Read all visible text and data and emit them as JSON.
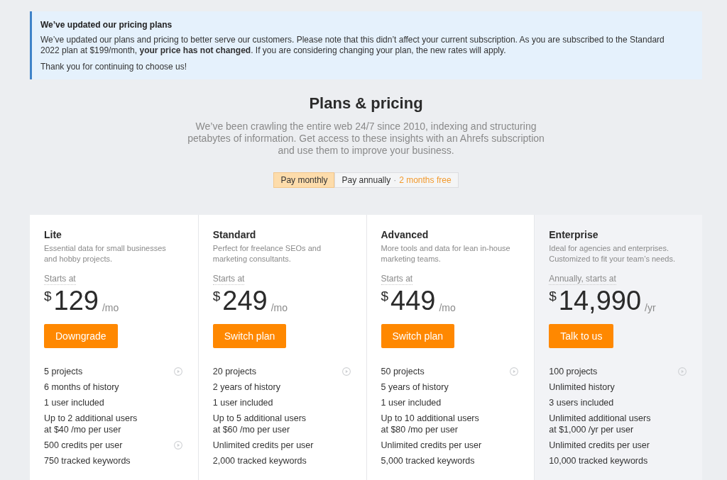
{
  "notice": {
    "title": "We’ve updated our pricing plans",
    "body": "We’ve updated our plans and pricing to better serve our customers. Please note that this didn’t affect your current subscription. As you are subscribed to the Standard 2022 plan at $199/month, **your price has not changed**. If you are considering changing your plan, the new rates will apply.",
    "closing": "Thank you for continuing to choose us!"
  },
  "header": {
    "title": "Plans & pricing",
    "subtitle": "We’ve been crawling the entire web 24/7 since 2010, indexing and structuring petabytes of information. Get access to these insights with an Ahrefs subscription and use them to improve your business."
  },
  "billing_toggle": [
    {
      "label": "Pay monthly",
      "selected": true
    },
    {
      "label": "Pay annually",
      "separator": "·",
      "badge": "2 months free",
      "selected": false
    }
  ],
  "plans": [
    {
      "name": "Lite",
      "description": "Essential data for small businesses and hobby projects.",
      "price_label": "Starts at",
      "currency": "$",
      "amount": "129",
      "period": "/mo",
      "button": "Downgrade",
      "highlighted": false,
      "features": [
        {
          "text": "5 projects",
          "video": true
        },
        {
          "text": "6 months of history",
          "video": false
        },
        {
          "text": "1 user included",
          "video": false
        },
        {
          "text": "Up to 2 additional users\nat $40 /mo per user",
          "video": false
        },
        {
          "text": "500 credits per user",
          "video": true
        },
        {
          "text": "750 tracked keywords",
          "video": false
        }
      ]
    },
    {
      "name": "Standard",
      "description": "Perfect for freelance SEOs and marketing consultants.",
      "price_label": "Starts at",
      "currency": "$",
      "amount": "249",
      "period": "/mo",
      "button": "Switch plan",
      "highlighted": false,
      "features": [
        {
          "text": "20 projects",
          "video": true
        },
        {
          "text": "2 years of history",
          "video": false
        },
        {
          "text": "1 user included",
          "video": false
        },
        {
          "text": "Up to 5 additional users\nat $60 /mo per user",
          "video": false
        },
        {
          "text": "Unlimited credits per user",
          "video": false
        },
        {
          "text": "2,000 tracked keywords",
          "video": false
        }
      ]
    },
    {
      "name": "Advanced",
      "description": "More tools and data for lean in-house marketing teams.",
      "price_label": "Starts at",
      "currency": "$",
      "amount": "449",
      "period": "/mo",
      "button": "Switch plan",
      "highlighted": false,
      "features": [
        {
          "text": "50 projects",
          "video": true
        },
        {
          "text": "5 years of history",
          "video": false
        },
        {
          "text": "1 user included",
          "video": false
        },
        {
          "text": "Up to 10 additional users\nat $80 /mo per user",
          "video": false
        },
        {
          "text": "Unlimited credits per user",
          "video": false
        },
        {
          "text": "5,000 tracked keywords",
          "video": false
        }
      ]
    },
    {
      "name": "Enterprise",
      "description": "Ideal for agencies and enterprises. Customized to fit your team’s needs.",
      "price_label": "Annually, starts at",
      "currency": "$",
      "amount": "14,990",
      "period": "/yr",
      "button": "Talk to us",
      "highlighted": true,
      "features": [
        {
          "text": "100 projects",
          "video": true
        },
        {
          "text": "Unlimited history",
          "video": false
        },
        {
          "text": "3 users included",
          "video": false
        },
        {
          "text": "Unlimited additional users\nat $1,000 /yr per user",
          "video": false
        },
        {
          "text": "Unlimited credits per user",
          "video": false
        },
        {
          "text": "10,000 tracked keywords",
          "video": false
        }
      ]
    }
  ]
}
